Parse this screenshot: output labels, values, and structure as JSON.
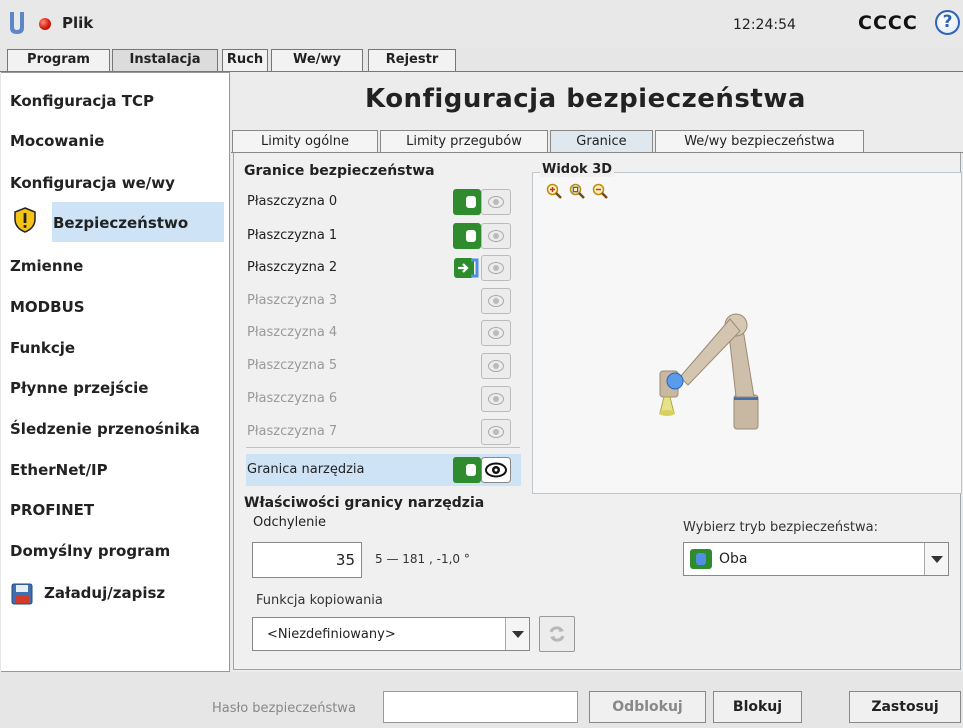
{
  "header": {
    "file_menu": "Plik",
    "clock": "12:24:54",
    "robot_name": "CCCC",
    "help_symbol": "?",
    "status_color": "#d41b0b"
  },
  "main_tabs": [
    {
      "label": "Program"
    },
    {
      "label": "Instalacja",
      "active": true
    },
    {
      "label": "Ruch"
    },
    {
      "label": "We/wy"
    },
    {
      "label": "Rejestr"
    }
  ],
  "sidebar": {
    "items": [
      {
        "label": "Konfiguracja TCP"
      },
      {
        "label": "Mocowanie"
      },
      {
        "label": "Konfiguracja we/wy"
      },
      {
        "label": "Bezpieczeństwo",
        "icon": "warning-shield-icon",
        "active": true
      },
      {
        "label": "Zmienne"
      },
      {
        "label": "MODBUS"
      },
      {
        "label": "Funkcje"
      },
      {
        "label": "Płynne przejście"
      },
      {
        "label": "Śledzenie przenośnika"
      },
      {
        "label": "EtherNet/IP"
      },
      {
        "label": "PROFINET"
      },
      {
        "label": "Domyślny program"
      },
      {
        "label": "Załaduj/zapisz",
        "icon": "floppy-disk-icon"
      }
    ]
  },
  "page": {
    "title": "Konfiguracja bezpieczeństwa",
    "sub_tabs": [
      {
        "label": "Limity ogólne"
      },
      {
        "label": "Limity przegubów"
      },
      {
        "label": "Granice",
        "active": true
      },
      {
        "label": "We/wy bezpieczeństwa"
      }
    ]
  },
  "boundaries": {
    "title": "Granice bezpieczeństwa",
    "planes": [
      {
        "label": "Płaszczyzna 0",
        "state": "enabled",
        "icon": "toggle-on-icon"
      },
      {
        "label": "Płaszczyzna 1",
        "state": "enabled",
        "icon": "toggle-on-icon"
      },
      {
        "label": "Płaszczyzna 2",
        "state": "enabled",
        "icon": "trigger-plane-icon"
      },
      {
        "label": "Płaszczyzna 3",
        "state": "disabled"
      },
      {
        "label": "Płaszczyzna 4",
        "state": "disabled"
      },
      {
        "label": "Płaszczyzna 5",
        "state": "disabled"
      },
      {
        "label": "Płaszczyzna 6",
        "state": "disabled"
      },
      {
        "label": "Płaszczyzna 7",
        "state": "disabled"
      }
    ],
    "tool_boundary": {
      "label": "Granica narzędzia",
      "visible": true
    }
  },
  "view3d": {
    "title": "Widok 3D",
    "icons": [
      "zoom-in-icon",
      "zoom-fit-icon",
      "zoom-out-icon"
    ]
  },
  "tool_properties": {
    "title": "Właściwości granicy narzędzia",
    "deviation_label": "Odchylenie",
    "deviation_value": "35",
    "deviation_range": "5 — 181 , -1,0 °",
    "mode_label": "Wybierz tryb bezpieczeństwa:",
    "mode_value": "Oba",
    "copy_label": "Funkcja kopiowania",
    "copy_value": "<Niezdefiniowany>"
  },
  "footer": {
    "password_label": "Hasło bezpieczeństwa",
    "password_value": "",
    "unlock_label": "Odblokuj",
    "lock_label": "Blokuj",
    "apply_label": "Zastosuj"
  },
  "colors": {
    "accent_blue": "#2f62b8",
    "active_bg": "#cfe3f6",
    "toggle_green": "#2e8c2e"
  }
}
